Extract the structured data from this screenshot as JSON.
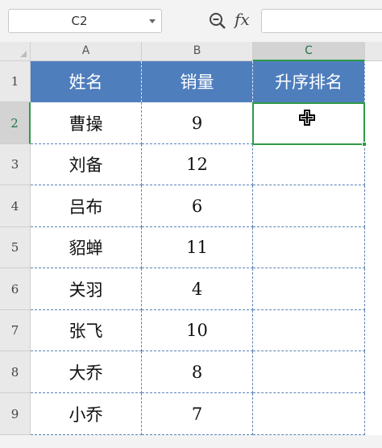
{
  "formula_bar": {
    "name_box": "C2",
    "zoom_icon": "zoom-icon",
    "fx_label": "fx",
    "formula": ""
  },
  "columns": [
    "A",
    "B",
    "C"
  ],
  "rows": [
    "1",
    "2",
    "3",
    "4",
    "5",
    "6",
    "7",
    "8",
    "9"
  ],
  "header_row": [
    "姓名",
    "销量",
    "升序排名"
  ],
  "data_rows": [
    [
      "曹操",
      "9",
      ""
    ],
    [
      "刘备",
      "12",
      ""
    ],
    [
      "吕布",
      "6",
      ""
    ],
    [
      "貂蝉",
      "11",
      ""
    ],
    [
      "关羽",
      "4",
      ""
    ],
    [
      "张飞",
      "10",
      ""
    ],
    [
      "大乔",
      "8",
      ""
    ],
    [
      "小乔",
      "7",
      ""
    ]
  ],
  "selection": {
    "cell": "C2",
    "color": "#2e9a47"
  },
  "colors": {
    "header_fill": "#4f7ebd",
    "grid_line": "#5b83b8"
  }
}
